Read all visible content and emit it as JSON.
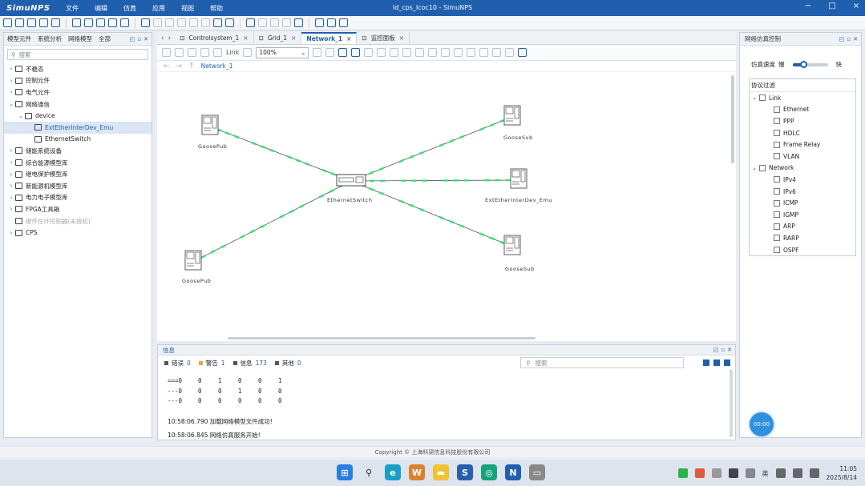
{
  "app": {
    "logo": "SimuNPS",
    "title": "ld_cps_lcoc10 - SimuNPS",
    "menu": [
      "文件",
      "编辑",
      "仿真",
      "应用",
      "视图",
      "帮助"
    ],
    "window_controls": [
      "−",
      "□",
      "×"
    ]
  },
  "left_panel": {
    "tabs": [
      "模型元件",
      "系统分析",
      "网络模型",
      "全部"
    ],
    "search_placeholder": "搜索",
    "tree": [
      {
        "arrow": "›",
        "label": "不稳态"
      },
      {
        "arrow": "›",
        "label": "控制元件"
      },
      {
        "arrow": "›",
        "label": "电气元件"
      },
      {
        "arrow": "⌄",
        "label": "网络通信"
      },
      {
        "arrow": "⌄",
        "label": "device",
        "indent": 1
      },
      {
        "arrow": "",
        "label": "ExtEtherInterDev_Emu",
        "indent": 2,
        "selected": true
      },
      {
        "arrow": "",
        "label": "EthernetSwitch",
        "indent": 2
      },
      {
        "arrow": "›",
        "label": "储能系统设备"
      },
      {
        "arrow": "›",
        "label": "综合能源模型库"
      },
      {
        "arrow": "›",
        "label": "继电保护模型库"
      },
      {
        "arrow": "›",
        "label": "新能源机模型库"
      },
      {
        "arrow": "›",
        "label": "电力电子模型库"
      },
      {
        "arrow": "›",
        "label": "FPGA工具箱"
      },
      {
        "arrow": "",
        "label": "硬件在环控制器(未授权)",
        "disabled": true
      },
      {
        "arrow": "›",
        "label": "CPS"
      }
    ]
  },
  "editor": {
    "tabs": [
      {
        "label": "Controlsystem_1",
        "active": false
      },
      {
        "label": "Grid_1",
        "active": false
      },
      {
        "label": "Network_1",
        "active": true
      },
      {
        "label": "监控面板",
        "active": false
      }
    ],
    "zoom": "100%",
    "link_label": "Link",
    "breadcrumb": "Network_1"
  },
  "network": {
    "nodes": [
      {
        "id": "n1",
        "label": "GooseSub"
      },
      {
        "id": "n2",
        "label": "GooseSub"
      },
      {
        "id": "sw",
        "label": "EthernetSwitch"
      },
      {
        "id": "n3",
        "label": "ExtEtherInterDev_Emu"
      },
      {
        "id": "n4",
        "label": "GoosePub"
      },
      {
        "id": "n5",
        "label": "GoosePub"
      }
    ],
    "link_color": "#33e06a"
  },
  "log": {
    "title": "信息",
    "filters": [
      {
        "label": "错误",
        "count": "0",
        "color": "#555555"
      },
      {
        "label": "警告",
        "count": "1",
        "color": "#f2a33a"
      },
      {
        "label": "信息",
        "count": "173",
        "color": "#555555"
      },
      {
        "label": "其他",
        "count": "0",
        "color": "#555555"
      }
    ],
    "search_placeholder": "搜索",
    "table": [
      [
        "===0",
        "0",
        "1",
        "0",
        "0",
        "1"
      ],
      [
        "---0",
        "0",
        "0",
        "1",
        "0",
        "0"
      ],
      [
        "---0",
        "0",
        "0",
        "0",
        "0",
        "0"
      ]
    ],
    "lines": [
      "10:58:06.790 加载网络模型文件成功!",
      "10:58:06.845 网络仿真服务开始!"
    ]
  },
  "right_panel": {
    "title": "网络仿真控制",
    "speed_label": "仿真速度",
    "slow": "慢",
    "fast": "快",
    "speed_level": 0.3,
    "protocols_title": "协议过滤",
    "groups": [
      {
        "label": "Link",
        "items": [
          "Ethernet",
          "PPP",
          "HDLC",
          "Frame Relay",
          "VLAN"
        ]
      },
      {
        "label": "Network",
        "items": [
          "IPv4",
          "IPv6",
          "ICMP",
          "IGMP",
          "ARP",
          "RARP",
          "OSPF"
        ]
      }
    ],
    "timer": "00:00"
  },
  "footer": "Copyright © 上海科梁信息科技股份有限公司",
  "taskbar": {
    "tray_lang": "英",
    "time": "11:05",
    "date": "2025/8/14"
  }
}
